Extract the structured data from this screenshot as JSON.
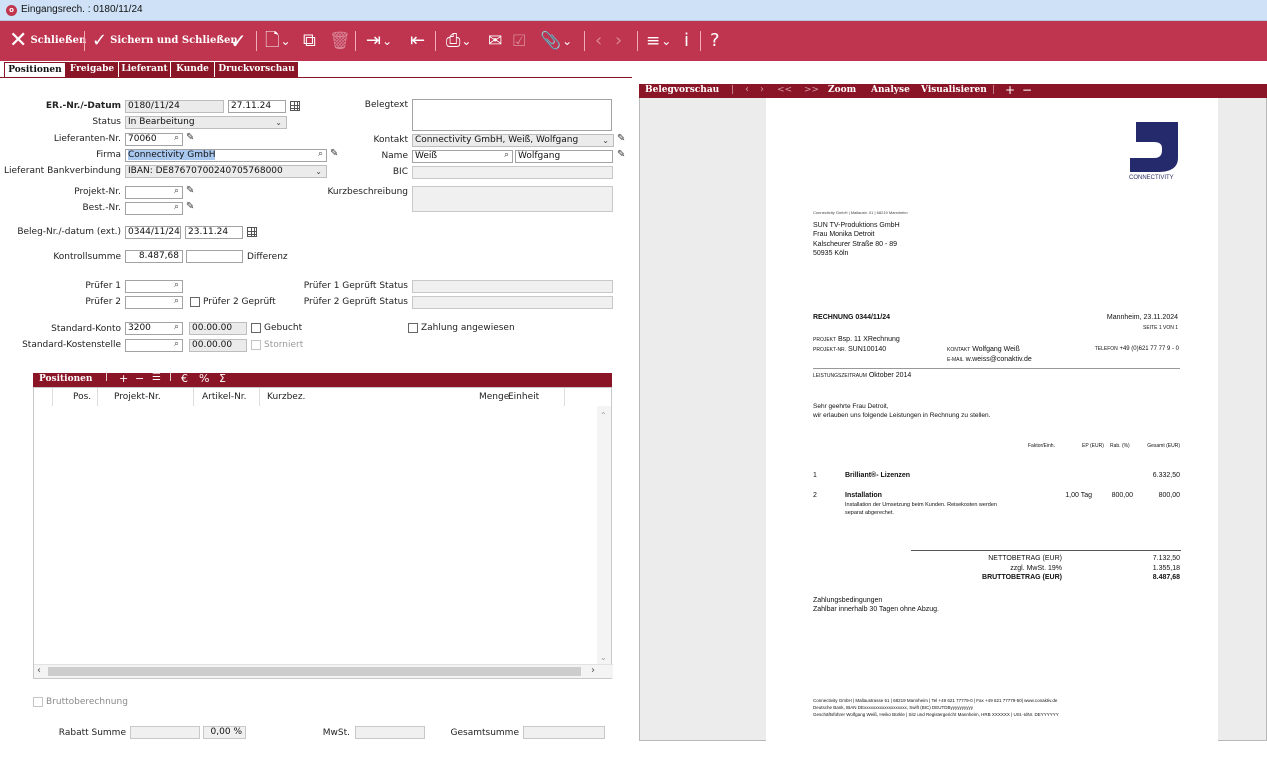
{
  "window": {
    "title": "Eingangsrech. : 0180/11/24"
  },
  "toolbar": {
    "close_label": "Schließen",
    "save_close_label": "Sichern und Schließen",
    "more_label": "?"
  },
  "tabs": [
    "Positionen",
    "Freigabe",
    "Lieferant",
    "Kunde",
    "Druckvorschau"
  ],
  "form": {
    "er_label": "ER.-Nr./-Datum",
    "er_nr": "0180/11/24",
    "er_datum": "27.11.24",
    "status_label": "Status",
    "status": "In Bearbeitung",
    "lieferanten_label": "Lieferanten-Nr.",
    "lieferanten_nr": "70060",
    "firma_label": "Firma",
    "firma": "Connectivity GmbH",
    "bank_label": "Lieferant Bankverbindung",
    "bank": "IBAN: DE87670700240705768000",
    "projekt_label": "Projekt-Nr.",
    "best_label": "Best.-Nr.",
    "belegnr_label": "Beleg-Nr./-datum (ext.)",
    "beleg_nr": "0344/11/24",
    "beleg_datum": "23.11.24",
    "kontroll_label": "Kontrollsumme",
    "kontroll": "8.487,68",
    "differenz_label": "Differenz",
    "pruefer1_label": "Prüfer 1",
    "pruefer2_label": "Prüfer 2",
    "pruefer2_geprueft_label": "Prüfer 2 Geprüft",
    "konto_label": "Standard-Konto",
    "konto": "3200",
    "konto_date": "00.00.00",
    "gebucht_label": "Gebucht",
    "kst_label": "Standard-Kostenstelle",
    "kst_date": "00.00.00",
    "storniert_label": "Storniert",
    "belegtext_label": "Belegtext",
    "kontakt_label": "Kontakt",
    "kontakt": "Connectivity GmbH, Weiß, Wolfgang",
    "name_label": "Name",
    "name_last": "Weiß",
    "name_first": "Wolfgang",
    "bic_label": "BIC",
    "kurz_label": "Kurzbeschreibung",
    "pruefer1_status_label": "Prüfer 1 Geprüft Status",
    "pruefer2_status_label": "Prüfer 2 Geprüft Status",
    "zahlung_label": "Zahlung angewiesen",
    "brutto_label": "Bruttoberechnung",
    "rabatt_label": "Rabatt Summe",
    "rabatt_pct": "0,00 %",
    "mwst_label": "MwSt.",
    "gesamt_label": "Gesamtsumme"
  },
  "positions": {
    "title": "Positionen",
    "columns": [
      "Pos.",
      "Projekt-Nr.",
      "Artikel-Nr.",
      "Kurzbez.",
      "Menge",
      "Einheit"
    ]
  },
  "preview": {
    "title": "Belegvorschau",
    "nav_first": "<<",
    "nav_last": ">>",
    "zoom": "Zoom",
    "analyse": "Analyse",
    "visualisieren": "Visualisieren"
  },
  "invoice": {
    "logo_text": "CONNECTIVITY",
    "sender_line": "Connectivity GmbH | Mallaustr. 01 | 68219 Mannheim",
    "recipient": [
      "SUN TV-Produktions GmbH",
      "Frau Monika Detroit",
      "Kalscheurer Straße 80 - 89",
      "50935 Köln"
    ],
    "heading": "RECHNUNG 0344/11/24",
    "date": "Mannheim, 23.11.2024",
    "page": "SEITE 1 VON 1",
    "projekt_key": "PROJEKT",
    "projekt_val": "Bsp. 11 XRechnung",
    "projektnr_key": "PROJEKT-NR.",
    "projektnr_val": "SUN100140",
    "kontakt_key": "KONTAKT",
    "kontakt_val": "Wolfgang Weiß",
    "telefon_key": "TELEFON",
    "telefon_val": "+49 (0)621 77 77 9 - 0",
    "email_key": "E-MAIL",
    "email_val": "w.weiss@conaktiv.de",
    "zeitraum_key": "LEISTUNGSZEITRAUM",
    "zeitraum_val": "Oktober 2014",
    "greeting": "Sehr geehrte Frau Detroit,",
    "intro": "wir erlauben uns folgende Leistungen in Rechnung zu stellen.",
    "col_faktor": "Faktor/Einh.",
    "col_ep": "EP (EUR)",
    "col_rab": "Rab. (%)",
    "col_gesamt": "Gesamt (EUR)",
    "items": [
      {
        "pos": "1",
        "title": "Brilliant®- Lizenzen",
        "qty": "",
        "ep": "",
        "total": "6.332,50",
        "desc": []
      },
      {
        "pos": "2",
        "title": "Installation",
        "qty": "1,00 Tag",
        "ep": "800,00",
        "total": "800,00",
        "desc": [
          "Installation der Umsetzung beim Kunden. Reisekosten werden",
          "separat abgerechet."
        ]
      }
    ],
    "netto_label": "NETTOBETRAG (EUR)",
    "netto": "7.132,50",
    "mwst_label": "zzgl. MwSt. 19%",
    "mwst": "1.355,18",
    "brutto_label": "BRUTTOBETRAG (EUR)",
    "brutto": "8.487,68",
    "terms_title": "Zahlungsbedingungen",
    "terms": "Zahlbar innerhalb 30 Tagen ohne Abzug.",
    "footer": [
      "Connectivity GmbH | Mallaustrasse 61 | 68219 Mannheim | Tel +49 621 77779-0 | Fax +49 621 77779-50| www.conaktiv.de",
      "Deutsche Bank, IBAN DExxxxxxxxxxxxxxxxxxx, Swift (BIC) DEUTDByyyyyyyyyy",
      "Geschäftsführer Wolfgang Weiß, Heiko Bürkle  | Sitz und Registergericht Mannheim, HRB XXXXXX | USt.-IdNr. DEYYYYYY"
    ]
  }
}
